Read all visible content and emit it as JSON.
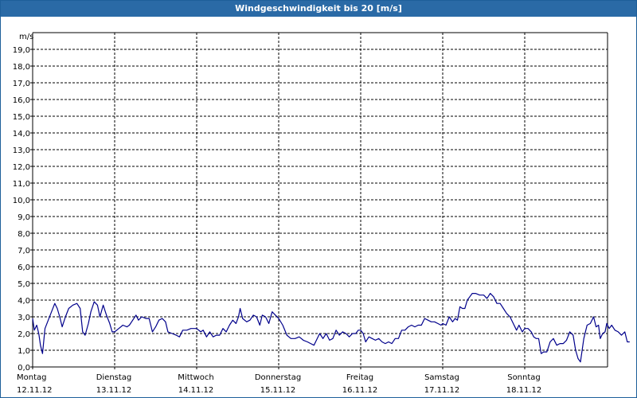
{
  "window": {
    "title": "Windgeschwindigkeit bis 20 [m/s]"
  },
  "colors": {
    "title_bar": "#2a6aa6",
    "series_line": "#00008b",
    "grid": "#000000"
  },
  "chart_data": {
    "type": "line",
    "title": "Windgeschwindigkeit bis 20 [m/s]",
    "ylabel": "m/s",
    "ylim": [
      0,
      20
    ],
    "ytick_labels": [
      "0,0",
      "1,0",
      "2,0",
      "3,0",
      "4,0",
      "5,0",
      "6,0",
      "7,0",
      "8,0",
      "9,0",
      "10,0",
      "11,0",
      "12,0",
      "13,0",
      "14,0",
      "15,0",
      "16,0",
      "17,0",
      "18,0",
      "19,0"
    ],
    "xlim": [
      0,
      7
    ],
    "x_unit": "days since Montag 12.11.12 00:00",
    "xtick_labels": [
      {
        "day": "Montag",
        "date": "12.11.12"
      },
      {
        "day": "Dienstag",
        "date": "13.11.12"
      },
      {
        "day": "Mittwoch",
        "date": "14.11.12"
      },
      {
        "day": "Donnerstag",
        "date": "15.11.12"
      },
      {
        "day": "Freitag",
        "date": "16.11.12"
      },
      {
        "day": "Samstag",
        "date": "17.11.12"
      },
      {
        "day": "Sonntag",
        "date": "18.11.12"
      }
    ],
    "grid": true,
    "grid_style": "dashed",
    "series": [
      {
        "values": [
          [
            0.0,
            2.9
          ],
          [
            0.02,
            2.2
          ],
          [
            0.05,
            2.5
          ],
          [
            0.075,
            2.0
          ],
          [
            0.095,
            1.3
          ],
          [
            0.12,
            0.8
          ],
          [
            0.15,
            2.3
          ],
          [
            0.19,
            2.8
          ],
          [
            0.23,
            3.3
          ],
          [
            0.27,
            3.8
          ],
          [
            0.3,
            3.5
          ],
          [
            0.33,
            3.0
          ],
          [
            0.36,
            2.4
          ],
          [
            0.4,
            3.0
          ],
          [
            0.44,
            3.5
          ],
          [
            0.49,
            3.7
          ],
          [
            0.54,
            3.8
          ],
          [
            0.58,
            3.5
          ],
          [
            0.61,
            2.1
          ],
          [
            0.64,
            1.9
          ],
          [
            0.68,
            2.6
          ],
          [
            0.71,
            3.3
          ],
          [
            0.75,
            3.9
          ],
          [
            0.79,
            3.7
          ],
          [
            0.82,
            3.0
          ],
          [
            0.86,
            3.7
          ],
          [
            0.9,
            3.1
          ],
          [
            0.94,
            2.6
          ],
          [
            0.97,
            2.1
          ],
          [
            1.0,
            2.1
          ],
          [
            1.05,
            2.3
          ],
          [
            1.1,
            2.5
          ],
          [
            1.15,
            2.4
          ],
          [
            1.18,
            2.5
          ],
          [
            1.22,
            2.8
          ],
          [
            1.26,
            3.1
          ],
          [
            1.29,
            2.8
          ],
          [
            1.33,
            3.0
          ],
          [
            1.38,
            2.9
          ],
          [
            1.42,
            2.9
          ],
          [
            1.46,
            2.1
          ],
          [
            1.5,
            2.4
          ],
          [
            1.54,
            2.8
          ],
          [
            1.58,
            2.9
          ],
          [
            1.62,
            2.7
          ],
          [
            1.65,
            2.1
          ],
          [
            1.7,
            2.0
          ],
          [
            1.75,
            1.9
          ],
          [
            1.79,
            1.8
          ],
          [
            1.83,
            2.2
          ],
          [
            1.88,
            2.2
          ],
          [
            1.93,
            2.3
          ],
          [
            2.0,
            2.3
          ],
          [
            2.05,
            2.1
          ],
          [
            2.08,
            2.2
          ],
          [
            2.12,
            1.8
          ],
          [
            2.16,
            2.1
          ],
          [
            2.2,
            1.8
          ],
          [
            2.24,
            1.9
          ],
          [
            2.28,
            1.9
          ],
          [
            2.32,
            2.3
          ],
          [
            2.36,
            2.1
          ],
          [
            2.4,
            2.5
          ],
          [
            2.44,
            2.8
          ],
          [
            2.48,
            2.6
          ],
          [
            2.51,
            3.0
          ],
          [
            2.53,
            3.5
          ],
          [
            2.56,
            2.9
          ],
          [
            2.61,
            2.7
          ],
          [
            2.65,
            2.8
          ],
          [
            2.69,
            3.1
          ],
          [
            2.73,
            3.0
          ],
          [
            2.77,
            2.5
          ],
          [
            2.8,
            3.1
          ],
          [
            2.84,
            3.0
          ],
          [
            2.88,
            2.6
          ],
          [
            2.92,
            3.3
          ],
          [
            2.96,
            3.1
          ],
          [
            3.0,
            2.9
          ],
          [
            3.05,
            2.5
          ],
          [
            3.1,
            1.9
          ],
          [
            3.15,
            1.7
          ],
          [
            3.2,
            1.7
          ],
          [
            3.25,
            1.8
          ],
          [
            3.3,
            1.6
          ],
          [
            3.35,
            1.5
          ],
          [
            3.39,
            1.4
          ],
          [
            3.43,
            1.3
          ],
          [
            3.46,
            1.6
          ],
          [
            3.5,
            2.0
          ],
          [
            3.54,
            1.7
          ],
          [
            3.58,
            2.0
          ],
          [
            3.62,
            1.6
          ],
          [
            3.66,
            1.7
          ],
          [
            3.7,
            2.2
          ],
          [
            3.74,
            1.9
          ],
          [
            3.78,
            2.1
          ],
          [
            3.82,
            2.0
          ],
          [
            3.86,
            1.8
          ],
          [
            3.9,
            2.0
          ],
          [
            3.94,
            2.0
          ],
          [
            3.97,
            2.2
          ],
          [
            4.0,
            2.2
          ],
          [
            4.03,
            2.0
          ],
          [
            4.06,
            1.5
          ],
          [
            4.1,
            1.8
          ],
          [
            4.14,
            1.7
          ],
          [
            4.18,
            1.6
          ],
          [
            4.22,
            1.7
          ],
          [
            4.26,
            1.5
          ],
          [
            4.3,
            1.4
          ],
          [
            4.34,
            1.5
          ],
          [
            4.38,
            1.4
          ],
          [
            4.42,
            1.7
          ],
          [
            4.46,
            1.7
          ],
          [
            4.5,
            2.2
          ],
          [
            4.54,
            2.2
          ],
          [
            4.58,
            2.4
          ],
          [
            4.62,
            2.5
          ],
          [
            4.66,
            2.4
          ],
          [
            4.7,
            2.5
          ],
          [
            4.74,
            2.5
          ],
          [
            4.78,
            2.9
          ],
          [
            4.82,
            2.8
          ],
          [
            4.86,
            2.7
          ],
          [
            4.9,
            2.7
          ],
          [
            4.94,
            2.6
          ],
          [
            4.98,
            2.5
          ],
          [
            5.0,
            2.6
          ],
          [
            5.04,
            2.5
          ],
          [
            5.08,
            3.0
          ],
          [
            5.12,
            2.7
          ],
          [
            5.15,
            2.9
          ],
          [
            5.18,
            2.8
          ],
          [
            5.21,
            3.6
          ],
          [
            5.24,
            3.5
          ],
          [
            5.27,
            3.5
          ],
          [
            5.3,
            4.0
          ],
          [
            5.33,
            4.2
          ],
          [
            5.36,
            4.4
          ],
          [
            5.4,
            4.4
          ],
          [
            5.45,
            4.3
          ],
          [
            5.5,
            4.3
          ],
          [
            5.54,
            4.1
          ],
          [
            5.58,
            4.4
          ],
          [
            5.62,
            4.2
          ],
          [
            5.66,
            3.8
          ],
          [
            5.7,
            3.8
          ],
          [
            5.74,
            3.5
          ],
          [
            5.78,
            3.2
          ],
          [
            5.82,
            3.0
          ],
          [
            5.86,
            2.6
          ],
          [
            5.9,
            2.2
          ],
          [
            5.93,
            2.5
          ],
          [
            5.97,
            2.1
          ],
          [
            6.0,
            2.3
          ],
          [
            6.04,
            2.3
          ],
          [
            6.08,
            2.1
          ],
          [
            6.11,
            1.8
          ],
          [
            6.14,
            1.7
          ],
          [
            6.17,
            1.7
          ],
          [
            6.2,
            0.8
          ],
          [
            6.23,
            0.9
          ],
          [
            6.27,
            0.9
          ],
          [
            6.31,
            1.5
          ],
          [
            6.35,
            1.7
          ],
          [
            6.39,
            1.3
          ],
          [
            6.43,
            1.4
          ],
          [
            6.47,
            1.4
          ],
          [
            6.51,
            1.6
          ],
          [
            6.55,
            2.1
          ],
          [
            6.59,
            1.9
          ],
          [
            6.62,
            1.0
          ],
          [
            6.65,
            0.5
          ],
          [
            6.68,
            0.3
          ],
          [
            6.72,
            1.7
          ],
          [
            6.76,
            2.5
          ],
          [
            6.8,
            2.6
          ],
          [
            6.84,
            3.0
          ],
          [
            6.87,
            2.4
          ],
          [
            6.9,
            2.5
          ],
          [
            6.92,
            1.7
          ],
          [
            6.95,
            2.0
          ],
          [
            6.98,
            2.1
          ],
          [
            7.0,
            2.6
          ],
          [
            7.03,
            2.3
          ],
          [
            7.06,
            2.5
          ],
          [
            7.1,
            2.2
          ],
          [
            7.14,
            2.1
          ],
          [
            7.18,
            1.9
          ],
          [
            7.22,
            2.1
          ],
          [
            7.25,
            1.5
          ],
          [
            7.28,
            1.5
          ]
        ]
      }
    ]
  }
}
